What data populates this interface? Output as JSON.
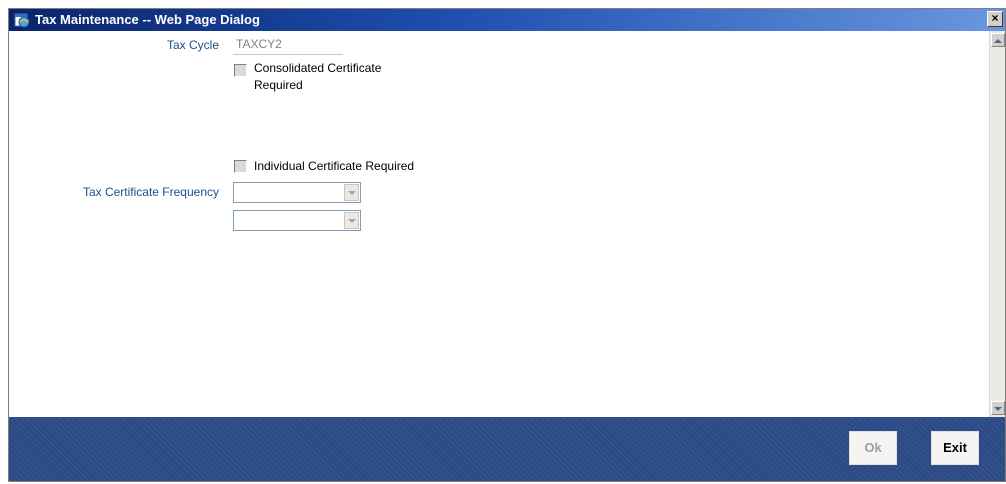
{
  "window": {
    "title": "Tax Maintenance -- Web Page Dialog",
    "close_label": "×",
    "icon": "web-page-dialog-icon"
  },
  "form": {
    "tax_cycle_label": "Tax Cycle",
    "tax_cycle_value": "TAXCY2",
    "consolidated_label_line1": "Consolidated Certificate",
    "consolidated_label_line2": "Required",
    "consolidated_checked": false,
    "individual_label": "Individual Certificate Required",
    "individual_checked": false,
    "frequency_label": "Tax Certificate Frequency",
    "frequency_select_1_value": "",
    "frequency_select_2_value": ""
  },
  "footer": {
    "ok_label": "Ok",
    "exit_label": "Exit"
  },
  "colors": {
    "label_blue": "#1d4f8e",
    "footer_blue": "#2c4a86",
    "titlebar_start": "#0a246a",
    "titlebar_end": "#6a97e0"
  }
}
